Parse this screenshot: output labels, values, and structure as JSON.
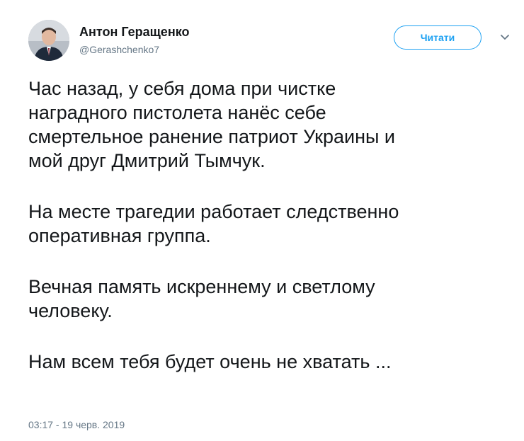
{
  "author": {
    "display_name": "Антон Геращенко",
    "handle": "@Gerashchenko7",
    "avatar_icon": "avatar-photo"
  },
  "header": {
    "follow_label": "Читати",
    "menu_icon": "chevron-down-icon"
  },
  "tweet": {
    "paragraphs": [
      "Час назад, у себя дома при чистке\nнаградного пистолета нанёс себе\nсмертельное ранение патриот Украины и\nмой друг Дмитрий Тымчук.",
      "На месте трагедии работает следственно\nоперативная группа.",
      "Вечная память искреннему и светлому\nчеловеку.",
      "Нам всем тебя будет очень не хватать ..."
    ],
    "timestamp": "03:17 - 19 черв. 2019"
  },
  "colors": {
    "accent": "#1da1f2",
    "text": "#14171a",
    "secondary": "#657786"
  }
}
